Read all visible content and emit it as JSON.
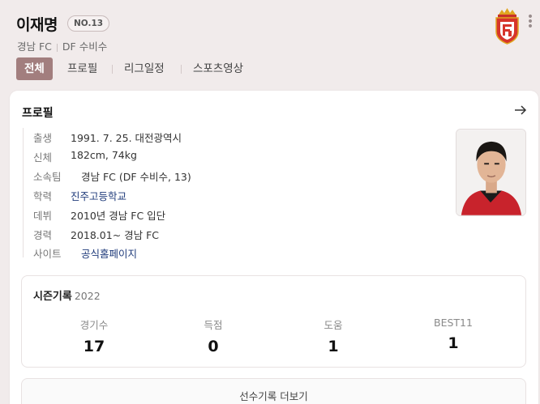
{
  "player": {
    "name": "이재명",
    "number": "NO.13",
    "team": "경남 FC",
    "position": "DF 수비수"
  },
  "tabs": [
    {
      "label": "전체",
      "active": true
    },
    {
      "label": "프로필",
      "active": false
    },
    {
      "label": "리그일정",
      "active": false
    },
    {
      "label": "스포츠영상",
      "active": false
    }
  ],
  "profile": {
    "title": "프로필",
    "rows": [
      {
        "key": "출생",
        "value": "1991. 7. 25. 대전광역시"
      },
      {
        "key": "신체",
        "value": "182cm, 74kg"
      },
      {
        "key": "소속팀",
        "value": "경남 FC (DF 수비수, 13)"
      },
      {
        "key": "학력",
        "value": "진주고등학교"
      },
      {
        "key": "데뷔",
        "value": "2010년 경남 FC 입단"
      },
      {
        "key": "경력",
        "value": "2018.01~ 경남 FC"
      },
      {
        "key": "사이트",
        "value": "공식홈페이지"
      }
    ]
  },
  "season": {
    "title": "시즌기록",
    "year": "2022",
    "stats": [
      {
        "label": "경기수",
        "value": "17"
      },
      {
        "label": "득점",
        "value": "0"
      },
      {
        "label": "도움",
        "value": "1"
      },
      {
        "label": "BEST11",
        "value": "1"
      }
    ]
  },
  "buttons": {
    "more_records": "선수기록 더보기"
  },
  "colors": {
    "accent": "#a27e7e",
    "background": "#f1ebeb",
    "link": "#1e3a7a"
  },
  "icons": {
    "team_logo": "gyeongnam-fc-emblem",
    "more_menu": "vertical-dots-icon",
    "arrow": "arrow-right-icon"
  }
}
